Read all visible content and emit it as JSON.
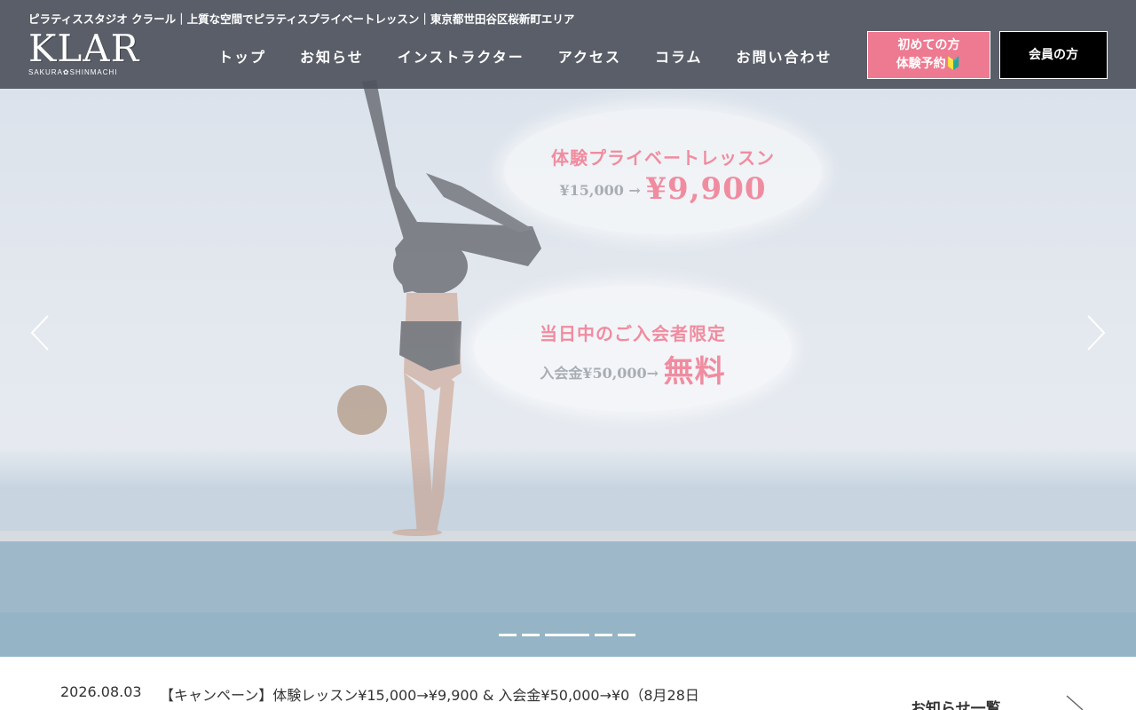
{
  "header": {
    "tagline": "ピラティススタジオ クラール｜上質な空間でピラティスプライベートレッスン｜東京都世田谷区桜新町エリア",
    "logo_text": "KLAR",
    "logo_sub": "SAKURA✿SHINMACHI",
    "nav": [
      "トップ",
      "お知らせ",
      "インストラクター",
      "アクセス",
      "コラム",
      "お問い合わせ"
    ],
    "trial_button_line1": "初めての方",
    "trial_button_line2": "体験予約🔰",
    "member_button": "会員の方"
  },
  "hero": {
    "promo1_title": "体験プライベートレッスン",
    "promo1_old": "¥15,000 →",
    "promo1_new": "¥9,900",
    "promo2_title": "当日中のご入会者限定",
    "promo2_old": "入会金¥50,000→",
    "promo2_new": "無料",
    "slide_count": 5,
    "active_slide": 3
  },
  "news": {
    "date": "2026.08.03",
    "title": "【キャンペーン】体験レッスン¥15,000→¥9,900 & 入会金¥50,000→¥0（8月28日",
    "more_label": "お知らせ一覧"
  },
  "colors": {
    "accent_pink": "#ee7a91",
    "header_bg": "#4e525c"
  }
}
